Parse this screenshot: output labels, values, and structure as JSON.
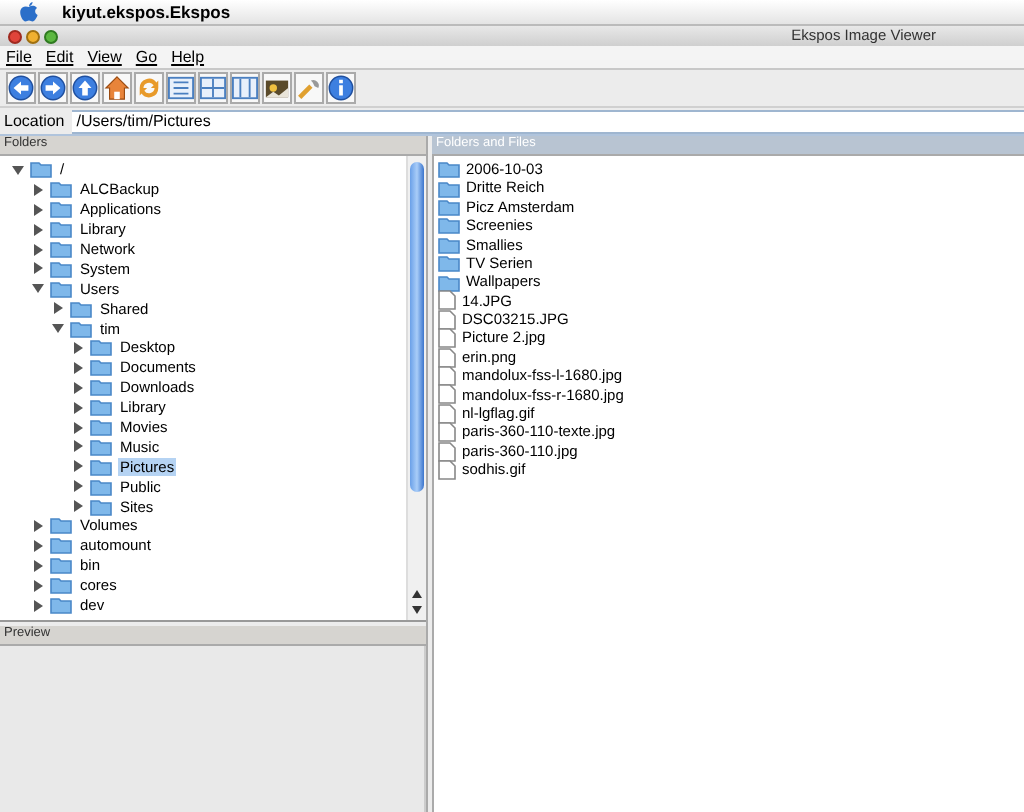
{
  "menubar_top": {
    "app_name": "kiyut.ekspos.Ekspos"
  },
  "window": {
    "title": "Ekspos Image Viewer"
  },
  "menu": [
    "File",
    "Edit",
    "View",
    "Go",
    "Help"
  ],
  "toolbar": [
    {
      "kind": "back"
    },
    {
      "kind": "forward"
    },
    {
      "kind": "up"
    },
    {
      "kind": "home"
    },
    {
      "kind": "refresh"
    },
    {
      "kind": "list"
    },
    {
      "kind": "thumbs"
    },
    {
      "kind": "details"
    },
    {
      "kind": "slideshow"
    },
    {
      "kind": "tools"
    },
    {
      "kind": "info"
    }
  ],
  "location": {
    "label": "Location",
    "value": "/Users/tim/Pictures"
  },
  "folders": {
    "title": "Folders",
    "tree": [
      {
        "label": "/",
        "expanded": true,
        "selected": false,
        "children": [
          {
            "label": "ALCBackup",
            "expanded": false,
            "selected": false
          },
          {
            "label": "Applications",
            "expanded": false,
            "selected": false
          },
          {
            "label": "Library",
            "expanded": false,
            "selected": false
          },
          {
            "label": "Network",
            "expanded": false,
            "selected": false
          },
          {
            "label": "System",
            "expanded": false,
            "selected": false
          },
          {
            "label": "Users",
            "expanded": true,
            "selected": false,
            "children": [
              {
                "label": "Shared",
                "expanded": false,
                "selected": false
              },
              {
                "label": "tim",
                "expanded": true,
                "selected": false,
                "children": [
                  {
                    "label": "Desktop",
                    "expanded": false,
                    "selected": false
                  },
                  {
                    "label": "Documents",
                    "expanded": false,
                    "selected": false
                  },
                  {
                    "label": "Downloads",
                    "expanded": false,
                    "selected": false
                  },
                  {
                    "label": "Library",
                    "expanded": false,
                    "selected": false
                  },
                  {
                    "label": "Movies",
                    "expanded": false,
                    "selected": false
                  },
                  {
                    "label": "Music",
                    "expanded": false,
                    "selected": false
                  },
                  {
                    "label": "Pictures",
                    "expanded": false,
                    "selected": true
                  },
                  {
                    "label": "Public",
                    "expanded": false,
                    "selected": false
                  },
                  {
                    "label": "Sites",
                    "expanded": false,
                    "selected": false
                  }
                ]
              }
            ]
          },
          {
            "label": "Volumes",
            "expanded": false,
            "selected": false
          },
          {
            "label": "automount",
            "expanded": false,
            "selected": false
          },
          {
            "label": "bin",
            "expanded": false,
            "selected": false
          },
          {
            "label": "cores",
            "expanded": false,
            "selected": false
          },
          {
            "label": "dev",
            "expanded": false,
            "selected": false
          }
        ]
      }
    ]
  },
  "preview": {
    "title": "Preview"
  },
  "files": {
    "title": "Folders and Files",
    "items": [
      {
        "name": "2006-10-03",
        "kind": "folder"
      },
      {
        "name": "Dritte Reich",
        "kind": "folder"
      },
      {
        "name": "Picz Amsterdam",
        "kind": "folder"
      },
      {
        "name": "Screenies",
        "kind": "folder"
      },
      {
        "name": "Smallies",
        "kind": "folder"
      },
      {
        "name": "TV Serien",
        "kind": "folder"
      },
      {
        "name": "Wallpapers",
        "kind": "folder"
      },
      {
        "name": "14.JPG",
        "kind": "file"
      },
      {
        "name": "DSC03215.JPG",
        "kind": "file"
      },
      {
        "name": "Picture 2.jpg",
        "kind": "file"
      },
      {
        "name": "erin.png",
        "kind": "file"
      },
      {
        "name": "mandolux-fss-l-1680.jpg",
        "kind": "file"
      },
      {
        "name": "mandolux-fss-r-1680.jpg",
        "kind": "file"
      },
      {
        "name": "nl-lgflag.gif",
        "kind": "file"
      },
      {
        "name": "paris-360-110-texte.jpg",
        "kind": "file"
      },
      {
        "name": "paris-360-110.jpg",
        "kind": "file"
      },
      {
        "name": "sodhis.gif",
        "kind": "file"
      }
    ]
  }
}
